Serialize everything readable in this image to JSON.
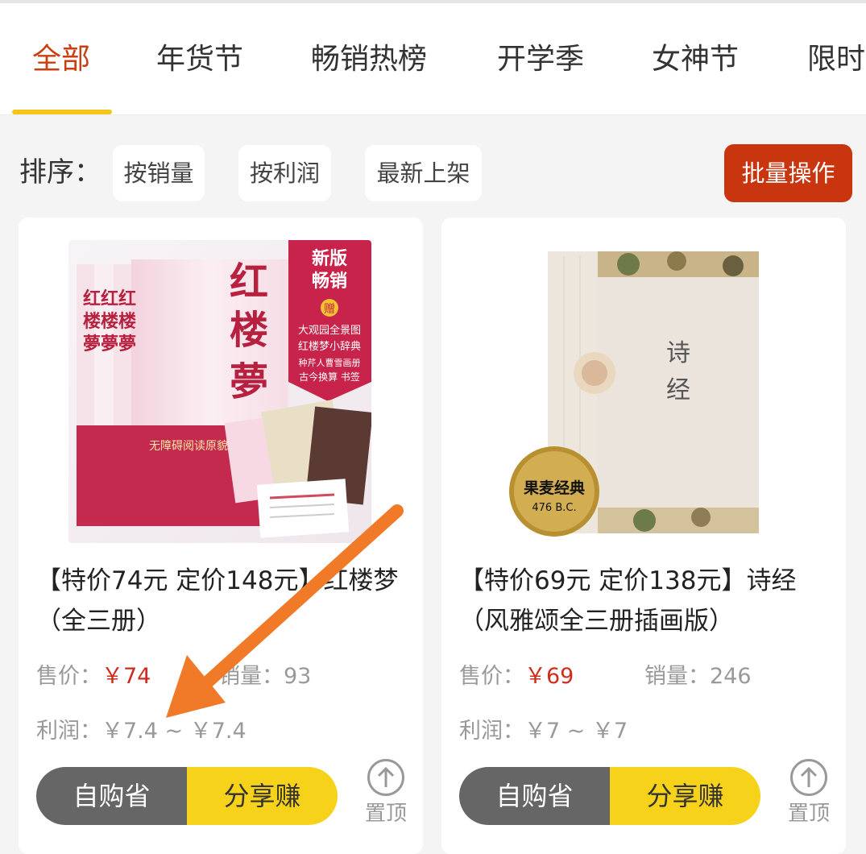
{
  "tabs": [
    {
      "label": "全部",
      "active": true
    },
    {
      "label": "年货节"
    },
    {
      "label": "畅销热榜"
    },
    {
      "label": "开学季"
    },
    {
      "label": "女神节"
    },
    {
      "label": "限时"
    }
  ],
  "sort": {
    "label": "排序：",
    "options": [
      "按销量",
      "按利润",
      "最新上架"
    ],
    "batch_label": "批量操作"
  },
  "products": [
    {
      "title": "【特价74元 定价148元】红楼梦（全三册）",
      "cover": {
        "book_title": "红楼夢",
        "badge": "新版畅销",
        "gift_label": "赠",
        "gifts": [
          "大观园全景图",
          "红楼梦小辞典",
          "种芹人曹雪画册",
          "古今换算 书签"
        ],
        "band_text": "无障碍阅读原貌《红"
      },
      "price_label": "售价：",
      "price": "￥74",
      "sales_label": "销量：",
      "sales": "93",
      "profit_label": "利润：",
      "profit": "￥7.4 ~ ￥7.4",
      "self_label": "自购省",
      "share_label": "分享赚",
      "pin_label": "置顶"
    },
    {
      "title": "【特价69元 定价138元】诗经（风雅颂全三册插画版）",
      "cover": {
        "book_title": "诗\n经",
        "seal_title": "果麦经典",
        "seal_sub": "476 B.C."
      },
      "price_label": "售价：",
      "price": "￥69",
      "sales_label": "销量：",
      "sales": "246",
      "profit_label": "利润：",
      "profit": "￥7 ~ ￥7",
      "self_label": "自购省",
      "share_label": "分享赚",
      "pin_label": "置顶"
    }
  ],
  "colors": {
    "accent": "#cc3e10",
    "tab_indicator": "#f5c518",
    "batch_button": "#c8350f",
    "price_red": "#d12b1d",
    "share_yellow": "#f7d21b",
    "annotation_arrow": "#f07a28"
  }
}
